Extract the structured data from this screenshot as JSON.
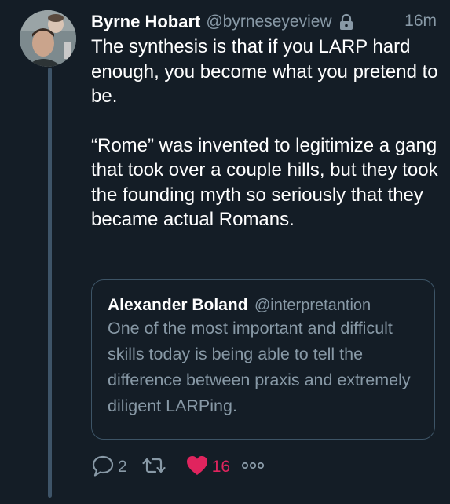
{
  "tweet": {
    "author_name": "Byrne Hobart",
    "author_handle": "@byrneseyeview",
    "timestamp": "16m",
    "protected_icon": "lock-icon",
    "paragraphs": [
      "The synthesis is that if you LARP hard enough, you become what you pretend to be.",
      "“Rome” was invented to legitimize a gang that took over a couple hills, but they took the founding myth so seriously that they became actual Romans."
    ]
  },
  "quoted_tweet": {
    "author_name": "Alexander Boland",
    "author_handle": "@interpretantion",
    "text": "One of the most important and difficult skills today is being able to tell the difference between praxis and extremely diligent LARPing."
  },
  "actions": {
    "reply_icon": "reply-icon",
    "reply_count": "2",
    "retweet_icon": "retweet-icon",
    "like_icon": "heart-icon",
    "like_count": "16",
    "more_icon": "more-icon"
  },
  "colors": {
    "background": "#141d26",
    "text_primary": "#ffffff",
    "text_secondary": "#8899a6",
    "like": "#e0245e",
    "border": "#3d5466"
  }
}
